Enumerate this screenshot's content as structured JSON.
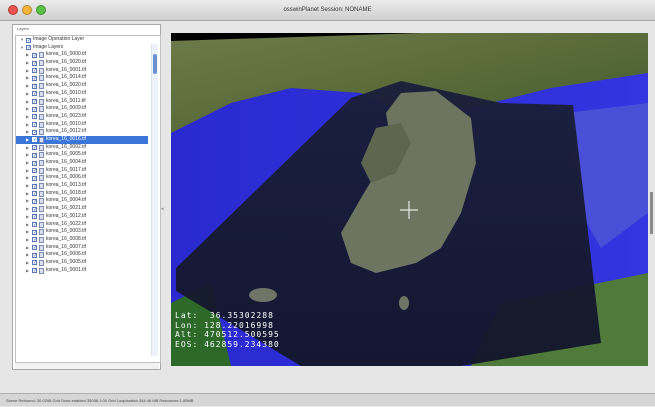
{
  "window": {
    "title": "osswinPlanet Session: NONAME"
  },
  "sidebar": {
    "panel_label": "Layers",
    "root_items": [
      {
        "label": "Image Operation Layer"
      },
      {
        "label": "Image Layers"
      }
    ],
    "items": [
      {
        "label": "korea_16_0000.tif",
        "checked": true
      },
      {
        "label": "korea_16_0020.tif",
        "checked": true
      },
      {
        "label": "korea_16_0001.tif",
        "checked": true
      },
      {
        "label": "korea_16_0014.tif",
        "checked": true
      },
      {
        "label": "korea_16_0020.tif",
        "checked": true
      },
      {
        "label": "korea_16_0010.tif",
        "checked": true
      },
      {
        "label": "korea_16_0011.tif",
        "checked": true
      },
      {
        "label": "korea_16_0009.tif",
        "checked": true
      },
      {
        "label": "korea_16_0023.tif",
        "checked": true
      },
      {
        "label": "korea_16_0010.tif",
        "checked": true
      },
      {
        "label": "korea_16_0012.tif",
        "checked": true
      },
      {
        "label": "korea_16_0016.tif",
        "checked": true,
        "selected": true
      },
      {
        "label": "korea_16_0002.tif",
        "checked": true
      },
      {
        "label": "korea_16_0005.tif",
        "checked": true
      },
      {
        "label": "korea_16_0004.tif",
        "checked": true
      },
      {
        "label": "korea_16_0017.tif",
        "checked": true
      },
      {
        "label": "korea_16_0006.tif",
        "checked": true
      },
      {
        "label": "korea_16_0013.tif",
        "checked": true
      },
      {
        "label": "korea_16_0018.tif",
        "checked": true
      },
      {
        "label": "korea_16_0004.tif",
        "checked": true
      },
      {
        "label": "korea_16_0021.tif",
        "checked": true
      },
      {
        "label": "korea_16_0012.tif",
        "checked": true
      },
      {
        "label": "korea_16_0022.tif",
        "checked": true
      },
      {
        "label": "korea_16_0003.tif",
        "checked": true
      },
      {
        "label": "korea_16_0008.tif",
        "checked": true
      },
      {
        "label": "korea_16_0007.tif",
        "checked": true
      },
      {
        "label": "korea_16_0006.tif",
        "checked": true
      },
      {
        "label": "korea_16_0005.tif",
        "checked": true
      },
      {
        "label": "korea_16_0001.tif",
        "checked": true
      }
    ]
  },
  "globe": {
    "readout": {
      "lat": "Lat:  36.35302288",
      "lon": "Lon: 128.22016998",
      "alt": "Alt: 470512.500595",
      "eos": "EOS: 462859.234380"
    },
    "crosshair_icon": "crosshair-icon"
  },
  "statusbar": {
    "text": "Scene Rebound: 30.0298  Grid Draw enabled  35058 1:00 Grid Loop/switch  344.46 MB Resources  1.85MB"
  },
  "colors": {
    "ocean": "#2b2bd8",
    "selection": "#3a75d8",
    "space": "#000000"
  }
}
